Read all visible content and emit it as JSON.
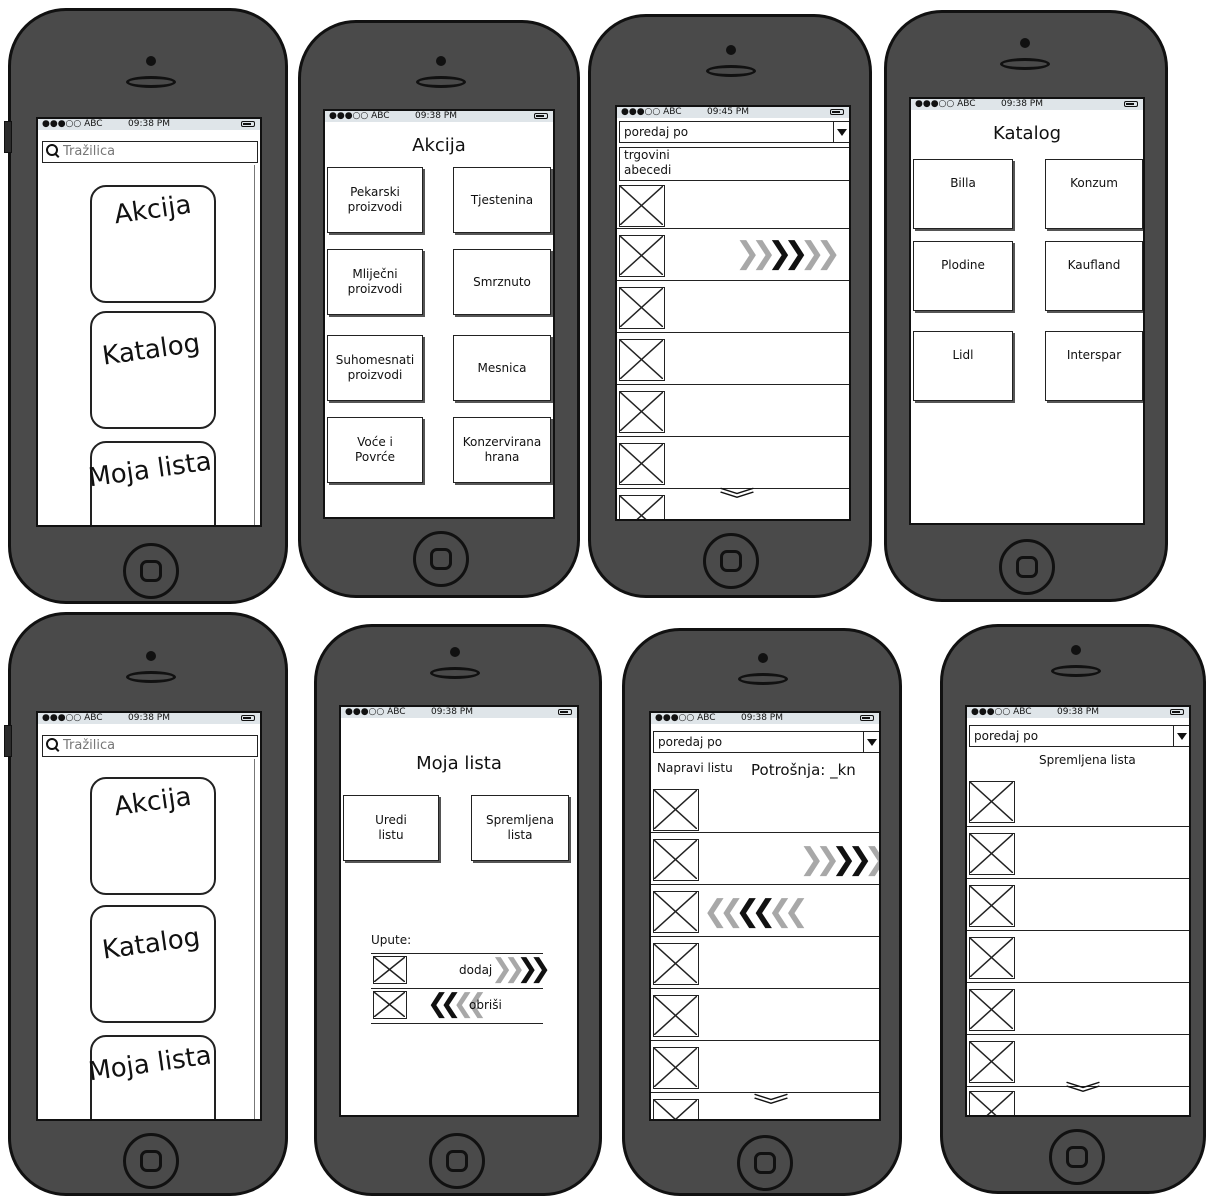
{
  "status": {
    "carrier": "●●●○○ ABC",
    "time_a": "09:38 PM",
    "time_b": "09:45 PM"
  },
  "home": {
    "search_placeholder": "Tražilica",
    "tiles": [
      "Akcija",
      "Katalog",
      "Moja lista"
    ]
  },
  "akcija": {
    "title": "Akcija",
    "categories": [
      "Pekarski\nproizvodi",
      "Tjestenina",
      "Mliječni\nproizvodi",
      "Smrznuto",
      "Suhomesnati\nproizvodi",
      "Mesnica",
      "Voće i\nPovrće",
      "Konzervirana\nhrana"
    ]
  },
  "sort": {
    "label": "poredaj po",
    "options": [
      "trgovini",
      "abecedi"
    ]
  },
  "katalog": {
    "title": "Katalog",
    "stores": [
      "Billa",
      "Konzum",
      "Plodine",
      "Kaufland",
      "Lidl",
      "Interspar"
    ]
  },
  "moja_lista": {
    "title": "Moja lista",
    "edit_button": "Uredi\nlistu",
    "saved_button": "Spremljena\nlista",
    "instructions_label": "Upute:",
    "add_hint": "dodaj",
    "delete_hint": "obriši"
  },
  "napravi": {
    "make_list": "Napravi listu",
    "spending": "Potrošnja: _kn"
  },
  "saved": {
    "title": "Spremljena lista"
  },
  "colors": {
    "phone_body": "#4a4a4a",
    "status_bar": "#dfe5e9",
    "chevron_light": "#a8a8a8"
  }
}
